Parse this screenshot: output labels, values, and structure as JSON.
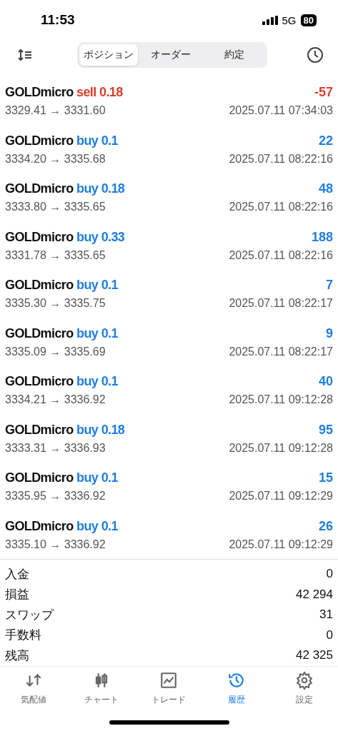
{
  "status_bar": {
    "time": "11:53",
    "network": "5G",
    "battery": "80"
  },
  "toolbar": {
    "tabs": [
      {
        "label": "ポジション",
        "selected": true
      },
      {
        "label": "オーダー",
        "selected": false
      },
      {
        "label": "約定",
        "selected": false
      }
    ]
  },
  "deals": [
    {
      "symbol": "GOLDmicro",
      "side": "sell",
      "volume": "0.18",
      "profit": "-57",
      "prices": "3329.41 → 3331.60",
      "time": "2025.07.11 07:34:03"
    },
    {
      "symbol": "GOLDmicro",
      "side": "buy",
      "volume": "0.1",
      "profit": "22",
      "prices": "3334.20 → 3335.68",
      "time": "2025.07.11 08:22:16"
    },
    {
      "symbol": "GOLDmicro",
      "side": "buy",
      "volume": "0.18",
      "profit": "48",
      "prices": "3333.80 → 3335.65",
      "time": "2025.07.11 08:22:16"
    },
    {
      "symbol": "GOLDmicro",
      "side": "buy",
      "volume": "0.33",
      "profit": "188",
      "prices": "3331.78 → 3335.65",
      "time": "2025.07.11 08:22:16"
    },
    {
      "symbol": "GOLDmicro",
      "side": "buy",
      "volume": "0.1",
      "profit": "7",
      "prices": "3335.30 → 3335.75",
      "time": "2025.07.11 08:22:17"
    },
    {
      "symbol": "GOLDmicro",
      "side": "buy",
      "volume": "0.1",
      "profit": "9",
      "prices": "3335.09 → 3335.69",
      "time": "2025.07.11 08:22:17"
    },
    {
      "symbol": "GOLDmicro",
      "side": "buy",
      "volume": "0.1",
      "profit": "40",
      "prices": "3334.21 → 3336.92",
      "time": "2025.07.11 09:12:28"
    },
    {
      "symbol": "GOLDmicro",
      "side": "buy",
      "volume": "0.18",
      "profit": "95",
      "prices": "3333.31 → 3336.93",
      "time": "2025.07.11 09:12:28"
    },
    {
      "symbol": "GOLDmicro",
      "side": "buy",
      "volume": "0.1",
      "profit": "15",
      "prices": "3335.95 → 3336.92",
      "time": "2025.07.11 09:12:29"
    },
    {
      "symbol": "GOLDmicro",
      "side": "buy",
      "volume": "0.1",
      "profit": "26",
      "prices": "3335.10 → 3336.92",
      "time": "2025.07.11 09:12:29"
    }
  ],
  "summary": [
    {
      "label": "入金",
      "value": "0"
    },
    {
      "label": "損益",
      "value": "42 294"
    },
    {
      "label": "スワップ",
      "value": "31"
    },
    {
      "label": "手数料",
      "value": "0"
    },
    {
      "label": "残高",
      "value": "42 325"
    }
  ],
  "tab_bar": [
    {
      "label": "気配値",
      "kind": "quotes",
      "selected": false
    },
    {
      "label": "チャート",
      "kind": "chart",
      "selected": false
    },
    {
      "label": "トレード",
      "kind": "trade",
      "selected": false
    },
    {
      "label": "履歴",
      "kind": "history",
      "selected": true
    },
    {
      "label": "設定",
      "kind": "settings",
      "selected": false
    }
  ]
}
